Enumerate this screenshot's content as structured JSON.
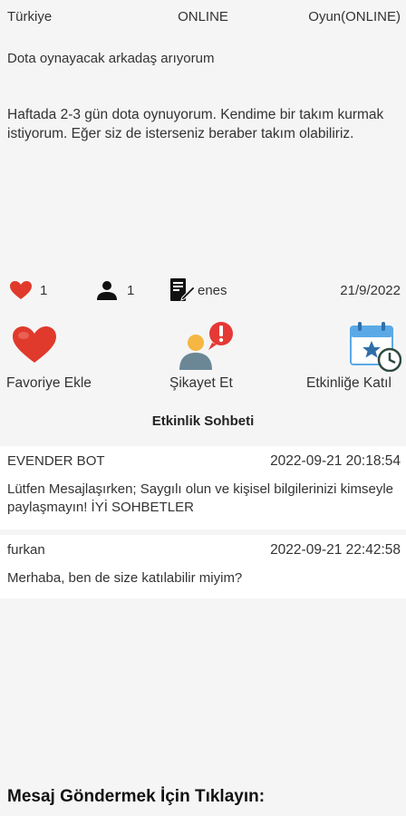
{
  "header": {
    "country": "Türkiye",
    "status": "ONLINE",
    "category": "Oyun(ONLINE)"
  },
  "event": {
    "title": "Dota oynayacak arkadaş arıyorum",
    "description": "Haftada 2-3 gün dota oynuyorum. Kendime bir takım kurmak istiyorum. Eğer siz de isterseniz beraber takım olabiliriz."
  },
  "stats": {
    "likes": "1",
    "participants": "1",
    "creator": "enes",
    "date": "21/9/2022"
  },
  "actions": {
    "favorite_label": "Favoriye Ekle",
    "report_label": "Şikayet Et",
    "join_label": "Etkinliğe Katıl"
  },
  "chat": {
    "title": "Etkinlik Sohbeti",
    "messages": [
      {
        "sender": "EVENDER BOT",
        "time": "2022-09-21 20:18:54",
        "text": "Lütfen Mesajlaşırken; Saygılı olun ve kişisel bilgilerinizi kimseyle paylaşmayın! İYİ SOHBETLER"
      },
      {
        "sender": "furkan",
        "time": "2022-09-21 22:42:58",
        "text": "Merhaba, ben de size katılabilir miyim?"
      }
    ]
  },
  "footer": {
    "send_prompt": "Mesaj Göndermek İçin Tıklayın:"
  },
  "colors": {
    "heart": "#e03a2c",
    "alert": "#e53935",
    "calendar": "#5aa9e6",
    "background": "#f5f5f5"
  }
}
